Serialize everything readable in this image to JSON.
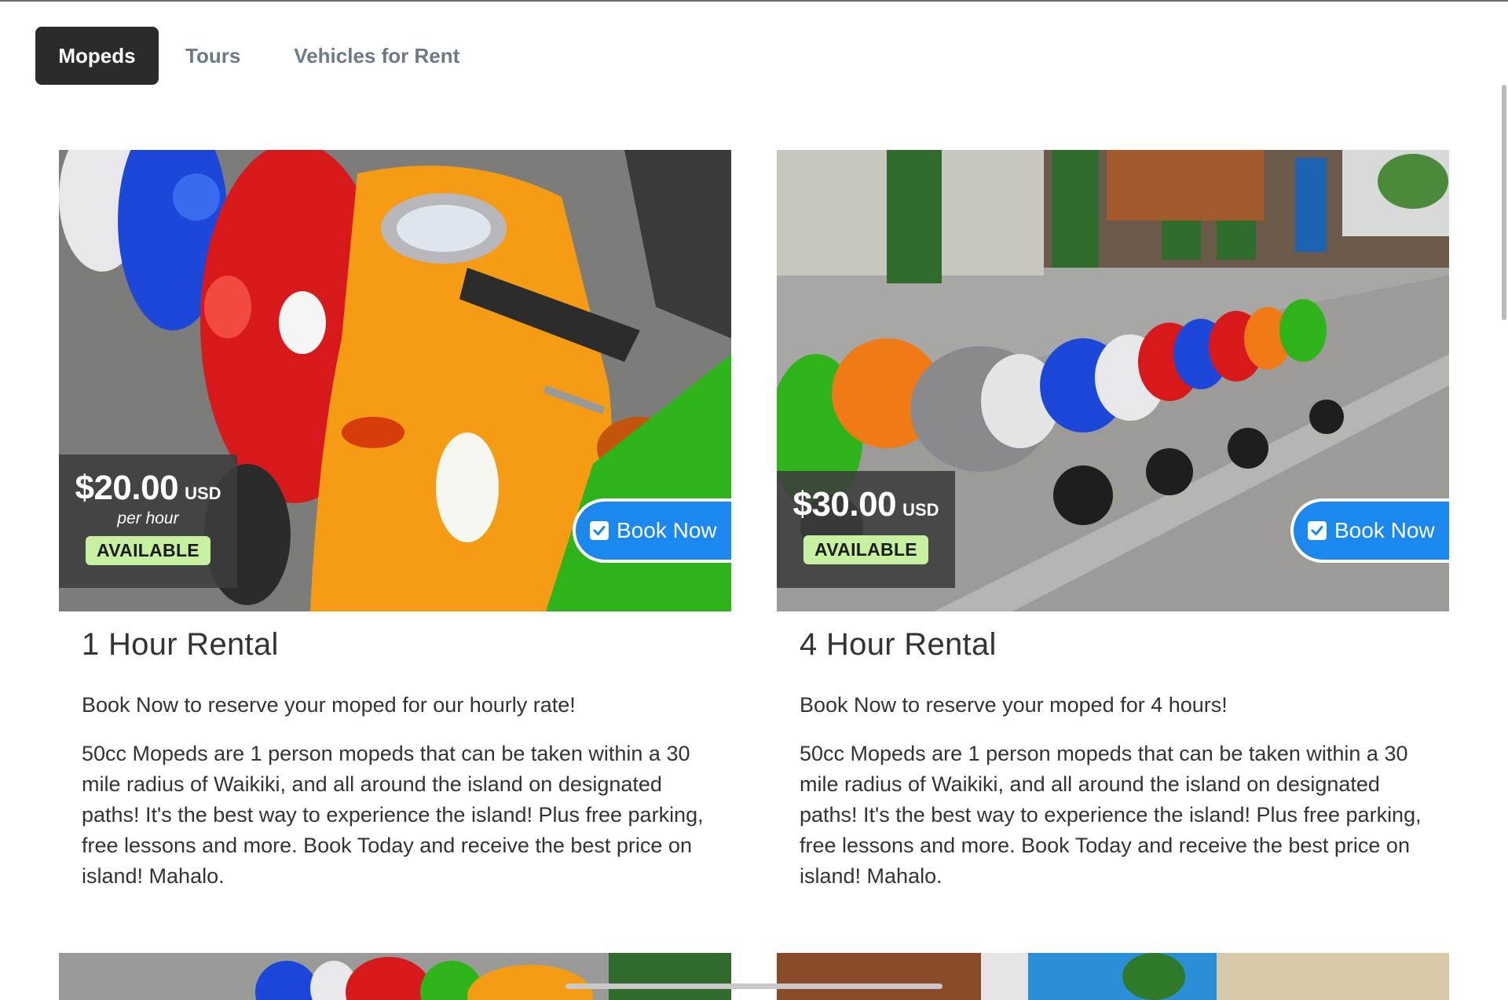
{
  "tabs": [
    {
      "label": "Mopeds",
      "active": true
    },
    {
      "label": "Tours",
      "active": false
    },
    {
      "label": "Vehicles for Rent",
      "active": false
    }
  ],
  "cards": [
    {
      "price": "$20.00",
      "currency": "USD",
      "unit": "per hour",
      "status": "AVAILABLE",
      "book_label": "Book Now",
      "title": "1 Hour Rental",
      "summary": "Book Now to reserve your moped for our hourly rate!",
      "description": "50cc Mopeds are 1 person mopeds that can be taken within a 30 mile radius of Waikiki, and all around the island on designated paths! It's the best way to experience the island! Plus free parking, free lessons and more. Book Today and receive the best price on island! Mahalo."
    },
    {
      "price": "$30.00",
      "currency": "USD",
      "status": "AVAILABLE",
      "book_label": "Book Now",
      "title": "4 Hour Rental",
      "summary": "Book Now to reserve your moped for 4 hours!",
      "description": "50cc Mopeds are 1 person mopeds that can be taken within a 30 mile radius of Waikiki, and all around the island on designated paths! It's the best way to experience the island! Plus free parking, free lessons and more. Book Today and receive the best price on island! Mahalo."
    }
  ],
  "colors": {
    "tab_active_bg": "#2b2b2b",
    "tab_inactive_text": "#6d7a88",
    "book_button": "#1a88ee",
    "available_badge": "#c7f0a0"
  },
  "icons": {
    "book_button_icon": "checkbox-checked-icon"
  }
}
